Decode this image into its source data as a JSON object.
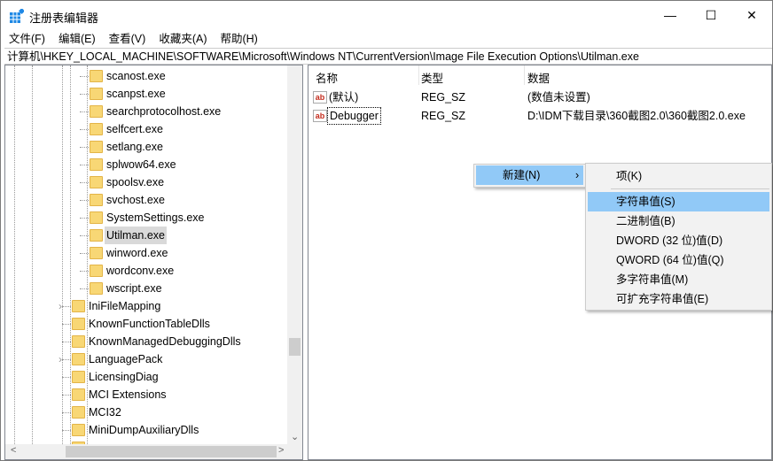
{
  "window": {
    "title": "注册表编辑器",
    "minimize": "—",
    "maximize": "☐",
    "close": "✕"
  },
  "menubar": [
    "文件(F)",
    "编辑(E)",
    "查看(V)",
    "收藏夹(A)",
    "帮助(H)"
  ],
  "address": "计算机\\HKEY_LOCAL_MACHINE\\SOFTWARE\\Microsoft\\Windows NT\\CurrentVersion\\Image File Execution Options\\Utilman.exe",
  "tree": {
    "children": [
      "scanost.exe",
      "scanpst.exe",
      "searchprotocolhost.exe",
      "selfcert.exe",
      "setlang.exe",
      "splwow64.exe",
      "spoolsv.exe",
      "svchost.exe",
      "SystemSettings.exe",
      "Utilman.exe",
      "winword.exe",
      "wordconv.exe",
      "wscript.exe"
    ],
    "selected": "Utilman.exe",
    "siblings": [
      {
        "label": "IniFileMapping",
        "expandable": true
      },
      {
        "label": "KnownFunctionTableDlls",
        "expandable": false
      },
      {
        "label": "KnownManagedDebuggingDlls",
        "expandable": false
      },
      {
        "label": "LanguagePack",
        "expandable": true
      },
      {
        "label": "LicensingDiag",
        "expandable": false
      },
      {
        "label": "MCI Extensions",
        "expandable": false
      },
      {
        "label": "MCI32",
        "expandable": false
      },
      {
        "label": "MiniDumpAuxiliaryDlls",
        "expandable": false
      }
    ]
  },
  "list": {
    "columns": [
      "名称",
      "类型",
      "数据"
    ],
    "rows": [
      {
        "name": "(默认)",
        "type": "REG_SZ",
        "data": "(数值未设置)"
      },
      {
        "name": "Debugger",
        "type": "REG_SZ",
        "data": "D:\\IDM下载目录\\360截图2.0\\360截图2.0.exe"
      }
    ]
  },
  "context_menu": {
    "new_label": "新建(N)",
    "arrow": "›",
    "submenu": [
      "项(K)",
      "字符串值(S)",
      "二进制值(B)",
      "DWORD (32 位)值(D)",
      "QWORD (64 位)值(Q)",
      "多字符串值(M)",
      "可扩充字符串值(E)"
    ],
    "highlighted": "字符串值(S)"
  },
  "colors": {
    "highlight": "#91c9f7",
    "selection": "#d9d9d9",
    "folder": "#f8d775"
  }
}
